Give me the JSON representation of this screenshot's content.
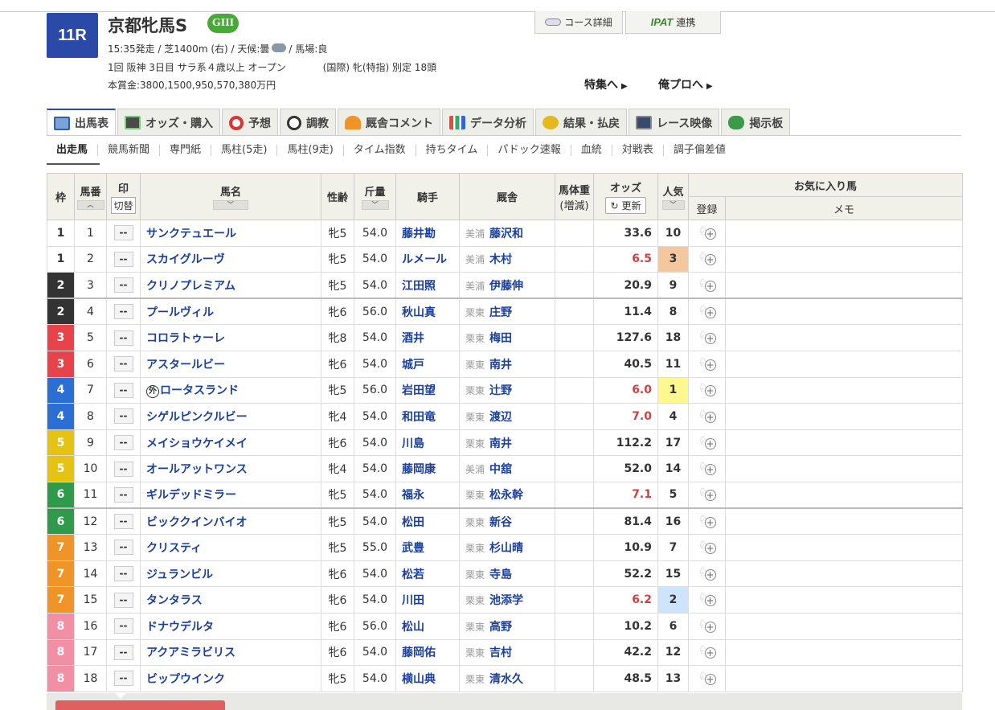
{
  "race": {
    "number": "11R",
    "name": "京都牝馬S",
    "grade": "GIII",
    "start_time": "15:35発走 /",
    "course": "芝1400m (右) /",
    "weather_label": "天候:曇",
    "track": "/ 馬場:良",
    "meeting": "1回 阪神 3日目 サラ系４歳以上 オープン",
    "conditions": "(国際) 牝(特指) 別定 18頭",
    "prize": "本賞金:3800,1500,950,570,380万円"
  },
  "header_buttons": {
    "course_detail": "コース詳細",
    "ipat_logo": "IPAT",
    "ipat_link": "連携"
  },
  "jump_links": {
    "special": "特集へ",
    "oreno_pro": "俺プロへ"
  },
  "tabs": [
    "出馬表",
    "オッズ・購入",
    "予想",
    "調教",
    "厩舎コメント",
    "データ分析",
    "結果・払戻",
    "レース映像",
    "掲示板"
  ],
  "subnav": [
    "出走馬",
    "競馬新聞",
    "専門紙",
    "馬柱(5走)",
    "馬柱(9走)",
    "タイム指数",
    "持ちタイム",
    "パドック速報",
    "血統",
    "対戦表",
    "調子偏差値"
  ],
  "table_headers": {
    "waku": "枠",
    "umaban": "馬番",
    "mark": "印",
    "mark_toggle": "切替",
    "horse": "馬名",
    "sexage": "性齢",
    "kinryo": "斤量",
    "jockey": "騎手",
    "trainer": "厩舎",
    "weight": "馬体重",
    "weight_sub": "(増減)",
    "odds": "オッズ",
    "odds_update": "更新",
    "ninki": "人気",
    "favorites": "お気に入り馬",
    "register": "登録",
    "memo": "メモ"
  },
  "colors": {
    "accent": "#2b4aa8",
    "grade": "#4aa83a",
    "link": "#1a3f9c",
    "low_odds": "#d04040"
  },
  "mark_placeholder": "--",
  "foreign_mark": "外",
  "entries": [
    {
      "waku": "1",
      "umaban": "1",
      "horse": "サンクテュエール",
      "sexage": "牝5",
      "kinryo": "54.0",
      "jockey": "藤井勘",
      "loc": "美浦",
      "trainer": "藤沢和",
      "odds": "33.6",
      "ninki": "10"
    },
    {
      "waku": "1",
      "umaban": "2",
      "horse": "スカイグルーヴ",
      "sexage": "牝5",
      "kinryo": "54.0",
      "jockey": "ルメール",
      "loc": "美浦",
      "trainer": "木村",
      "odds": "6.5",
      "ninki": "3"
    },
    {
      "waku": "2",
      "umaban": "3",
      "horse": "クリノプレミアム",
      "sexage": "牝5",
      "kinryo": "54.0",
      "jockey": "江田照",
      "loc": "美浦",
      "trainer": "伊藤伸",
      "odds": "20.9",
      "ninki": "9"
    },
    {
      "waku": "2",
      "umaban": "4",
      "horse": "プールヴィル",
      "sexage": "牝6",
      "kinryo": "56.0",
      "jockey": "秋山真",
      "loc": "栗東",
      "trainer": "庄野",
      "odds": "11.4",
      "ninki": "8"
    },
    {
      "waku": "3",
      "umaban": "5",
      "horse": "コロラトゥーレ",
      "sexage": "牝8",
      "kinryo": "54.0",
      "jockey": "酒井",
      "loc": "栗東",
      "trainer": "梅田",
      "odds": "127.6",
      "ninki": "18"
    },
    {
      "waku": "3",
      "umaban": "6",
      "horse": "アスタールビー",
      "sexage": "牝6",
      "kinryo": "54.0",
      "jockey": "城戸",
      "loc": "栗東",
      "trainer": "南井",
      "odds": "40.5",
      "ninki": "11"
    },
    {
      "waku": "4",
      "umaban": "7",
      "horse": "ロータスランド",
      "foreign": true,
      "sexage": "牝5",
      "kinryo": "56.0",
      "jockey": "岩田望",
      "loc": "栗東",
      "trainer": "辻野",
      "odds": "6.0",
      "ninki": "1"
    },
    {
      "waku": "4",
      "umaban": "8",
      "horse": "シゲルピンクルビー",
      "sexage": "牝4",
      "kinryo": "54.0",
      "jockey": "和田竜",
      "loc": "栗東",
      "trainer": "渡辺",
      "odds": "7.0",
      "ninki": "4"
    },
    {
      "waku": "5",
      "umaban": "9",
      "horse": "メイショウケイメイ",
      "sexage": "牝6",
      "kinryo": "54.0",
      "jockey": "川島",
      "loc": "栗東",
      "trainer": "南井",
      "odds": "112.2",
      "ninki": "17"
    },
    {
      "waku": "5",
      "umaban": "10",
      "horse": "オールアットワンス",
      "sexage": "牝4",
      "kinryo": "54.0",
      "jockey": "藤岡康",
      "loc": "美浦",
      "trainer": "中舘",
      "odds": "52.0",
      "ninki": "14"
    },
    {
      "waku": "6",
      "umaban": "11",
      "horse": "ギルデッドミラー",
      "sexage": "牝5",
      "kinryo": "54.0",
      "jockey": "福永",
      "loc": "栗東",
      "trainer": "松永幹",
      "odds": "7.1",
      "ninki": "5"
    },
    {
      "waku": "6",
      "umaban": "12",
      "horse": "ビッククインバイオ",
      "sexage": "牝5",
      "kinryo": "54.0",
      "jockey": "松田",
      "loc": "栗東",
      "trainer": "新谷",
      "odds": "81.4",
      "ninki": "16"
    },
    {
      "waku": "7",
      "umaban": "13",
      "horse": "クリスティ",
      "sexage": "牝5",
      "kinryo": "55.0",
      "jockey": "武豊",
      "loc": "栗東",
      "trainer": "杉山晴",
      "odds": "10.9",
      "ninki": "7"
    },
    {
      "waku": "7",
      "umaban": "14",
      "horse": "ジュランビル",
      "sexage": "牝6",
      "kinryo": "54.0",
      "jockey": "松若",
      "loc": "栗東",
      "trainer": "寺島",
      "odds": "52.2",
      "ninki": "15"
    },
    {
      "waku": "7",
      "umaban": "15",
      "horse": "タンタラス",
      "sexage": "牝6",
      "kinryo": "54.0",
      "jockey": "川田",
      "loc": "栗東",
      "trainer": "池添学",
      "odds": "6.2",
      "ninki": "2"
    },
    {
      "waku": "8",
      "umaban": "16",
      "horse": "ドナウデルタ",
      "sexage": "牝6",
      "kinryo": "56.0",
      "jockey": "松山",
      "loc": "栗東",
      "trainer": "高野",
      "odds": "10.2",
      "ninki": "6"
    },
    {
      "waku": "8",
      "umaban": "17",
      "horse": "アクアミラビリス",
      "sexage": "牝6",
      "kinryo": "54.0",
      "jockey": "藤岡佑",
      "loc": "栗東",
      "trainer": "吉村",
      "odds": "42.2",
      "ninki": "12"
    },
    {
      "waku": "8",
      "umaban": "18",
      "horse": "ビップウインク",
      "sexage": "牝5",
      "kinryo": "54.0",
      "jockey": "横山典",
      "loc": "栗東",
      "trainer": "清水久",
      "odds": "48.5",
      "ninki": "13"
    }
  ]
}
